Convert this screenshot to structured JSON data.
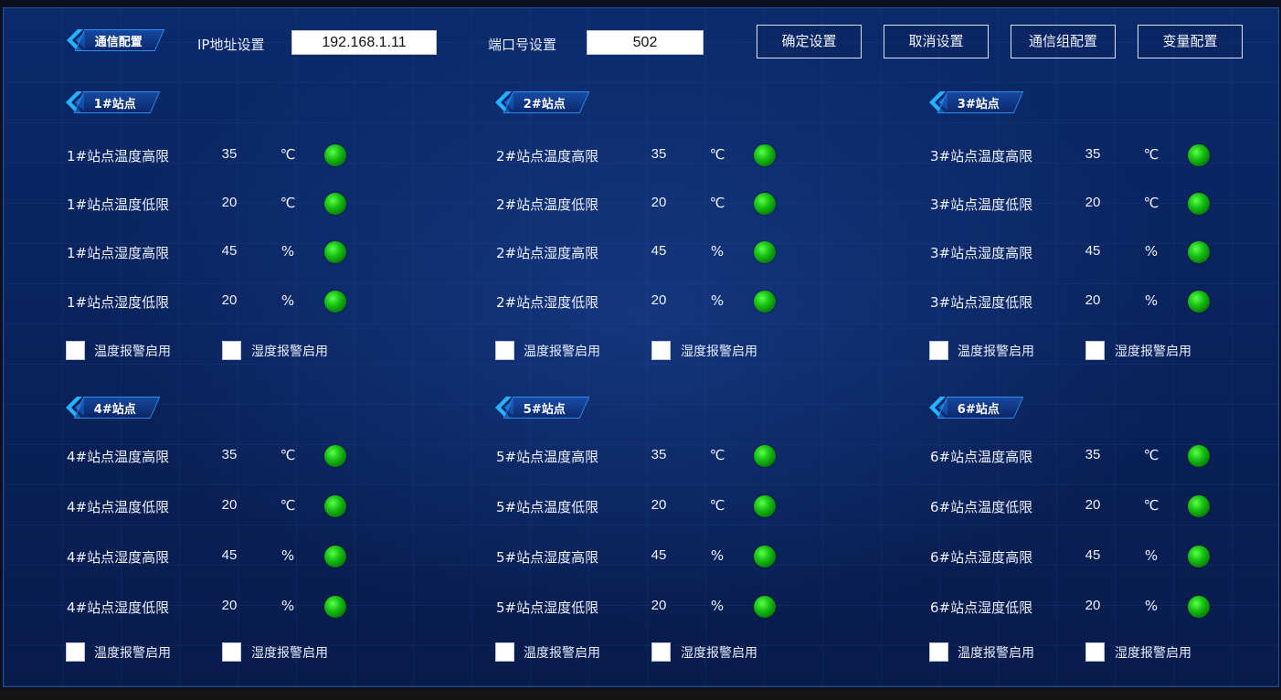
{
  "header": {
    "tag": "通信配置",
    "ip_label": "IP地址设置",
    "ip_value": "192.168.1.11",
    "port_label": "端口号设置",
    "port_value": "502",
    "buttons": [
      "确定设置",
      "取消设置",
      "通信组配置",
      "变量配置"
    ]
  },
  "status_color": "#16c112",
  "stations": [
    {
      "title": "1#站点",
      "rows": [
        {
          "name": "1#站点温度高限",
          "value": "35",
          "unit": "℃"
        },
        {
          "name": "1#站点温度低限",
          "value": "20",
          "unit": "℃"
        },
        {
          "name": "1#站点湿度高限",
          "value": "45",
          "unit": "%"
        },
        {
          "name": "1#站点湿度低限",
          "value": "20",
          "unit": "%"
        }
      ],
      "checks": [
        "温度报警启用",
        "湿度报警启用"
      ]
    },
    {
      "title": "2#站点",
      "rows": [
        {
          "name": "2#站点温度高限",
          "value": "35",
          "unit": "℃"
        },
        {
          "name": "2#站点温度低限",
          "value": "20",
          "unit": "℃"
        },
        {
          "name": "2#站点湿度高限",
          "value": "45",
          "unit": "%"
        },
        {
          "name": "2#站点湿度低限",
          "value": "20",
          "unit": "%"
        }
      ],
      "checks": [
        "温度报警启用",
        "湿度报警启用"
      ]
    },
    {
      "title": "3#站点",
      "rows": [
        {
          "name": "3#站点温度高限",
          "value": "35",
          "unit": "℃"
        },
        {
          "name": "3#站点温度低限",
          "value": "20",
          "unit": "℃"
        },
        {
          "name": "3#站点湿度高限",
          "value": "45",
          "unit": "%"
        },
        {
          "name": "3#站点湿度低限",
          "value": "20",
          "unit": "%"
        }
      ],
      "checks": [
        "温度报警启用",
        "湿度报警启用"
      ]
    },
    {
      "title": "4#站点",
      "rows": [
        {
          "name": "4#站点温度高限",
          "value": "35",
          "unit": "℃"
        },
        {
          "name": "4#站点温度低限",
          "value": "20",
          "unit": "℃"
        },
        {
          "name": "4#站点湿度高限",
          "value": "45",
          "unit": "%"
        },
        {
          "name": "4#站点湿度低限",
          "value": "20",
          "unit": "%"
        }
      ],
      "checks": [
        "温度报警启用",
        "湿度报警启用"
      ]
    },
    {
      "title": "5#站点",
      "rows": [
        {
          "name": "5#站点温度高限",
          "value": "35",
          "unit": "℃"
        },
        {
          "name": "5#站点温度低限",
          "value": "20",
          "unit": "℃"
        },
        {
          "name": "5#站点湿度高限",
          "value": "45",
          "unit": "%"
        },
        {
          "name": "5#站点湿度低限",
          "value": "20",
          "unit": "%"
        }
      ],
      "checks": [
        "温度报警启用",
        "湿度报警启用"
      ]
    },
    {
      "title": "6#站点",
      "rows": [
        {
          "name": "6#站点温度高限",
          "value": "35",
          "unit": "℃"
        },
        {
          "name": "6#站点温度低限",
          "value": "20",
          "unit": "℃"
        },
        {
          "name": "6#站点湿度高限",
          "value": "45",
          "unit": "%"
        },
        {
          "name": "6#站点湿度低限",
          "value": "20",
          "unit": "%"
        }
      ],
      "checks": [
        "温度报警启用",
        "湿度报警启用"
      ]
    }
  ]
}
